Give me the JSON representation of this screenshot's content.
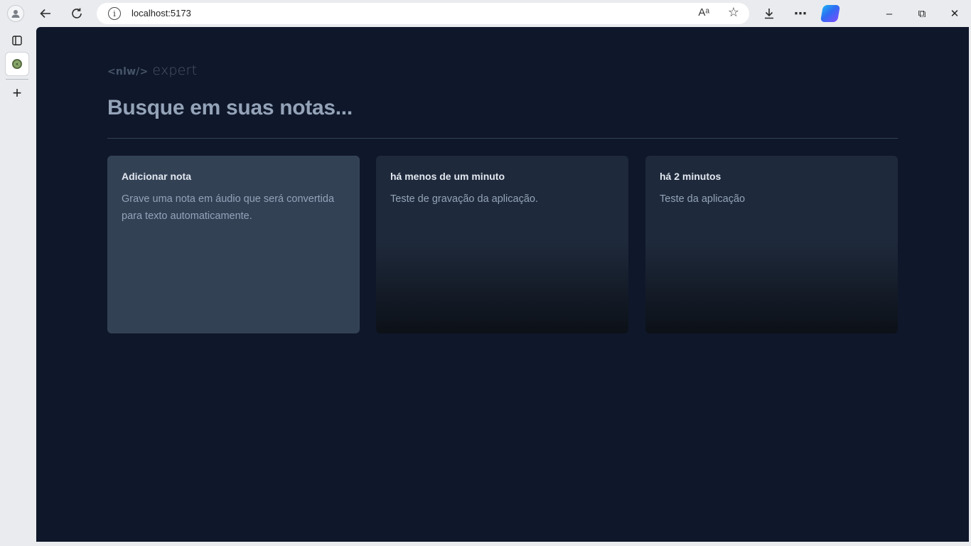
{
  "browser": {
    "url": "localhost:5173",
    "icons": {
      "profile": "profile-icon",
      "back": "back-arrow-icon",
      "reload": "reload-icon",
      "info": "info-icon",
      "read_aloud": "read-aloud-icon",
      "favorite": "star-icon",
      "downloads": "download-icon",
      "menu": "more-icon",
      "copilot": "copilot-icon",
      "tab_actions": "tab-actions-icon",
      "new_tab": "plus-icon"
    },
    "read_aloud_glyph": "Aᵃ",
    "window_controls": {
      "minimize": "–",
      "restore": "⧉",
      "close": "✕"
    }
  },
  "app": {
    "brand_tag": "<nlw/>",
    "brand_word": "expert",
    "search_placeholder": "Busque em suas notas...",
    "add_card": {
      "title": "Adicionar nota",
      "text": "Grave uma nota em áudio que será convertida para texto automaticamente."
    },
    "notes": [
      {
        "date": "há menos de um minuto",
        "content": "Teste de gravação da aplicação."
      },
      {
        "date": "há 2 minutos",
        "content": "Teste da aplicação"
      }
    ]
  },
  "colors": {
    "background": "#0f172a",
    "card_add": "#334155",
    "card_note": "#1e293b",
    "text_light": "#e2e8f0",
    "text_muted": "#94a3b8"
  }
}
